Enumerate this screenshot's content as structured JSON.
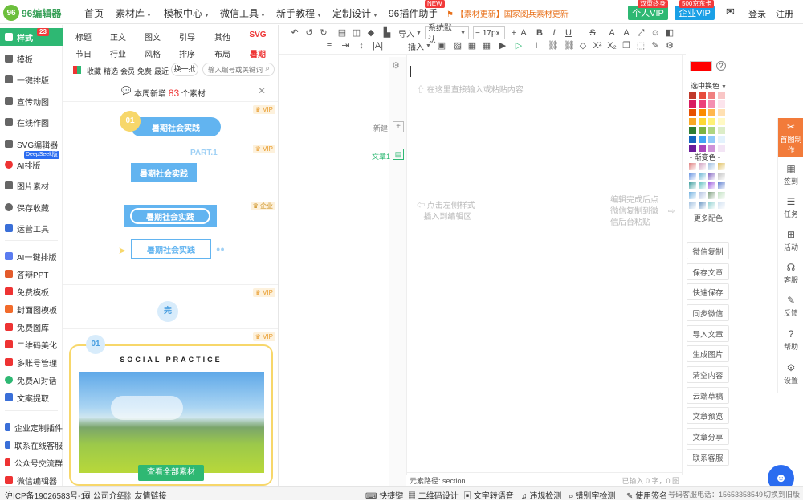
{
  "brand": {
    "name": "96编辑器",
    "accent": "#2eb873"
  },
  "topnav": {
    "items": [
      "首页",
      "素材库",
      "模板中心",
      "微信工具",
      "新手教程",
      "定制设计",
      "96插件助手"
    ],
    "new_badge": "NEW",
    "news": "【素材更新】国家阅兵素材更新",
    "vip_personal": "个人VIP",
    "vip_personal_badge": "双重终身",
    "vip_enterprise": "企业VIP",
    "vip_enterprise_badge": "500京东卡",
    "login": "登录",
    "register": "注册"
  },
  "sidebar": {
    "items": [
      {
        "label": "样式",
        "badge": "23"
      },
      {
        "label": "模板"
      },
      {
        "label": "一键排版"
      },
      {
        "label": "宣传动图"
      },
      {
        "label": "在线作图"
      },
      {
        "label": "SVG编辑器"
      },
      {
        "label": "AI排版",
        "badge": "DeepSeek版"
      },
      {
        "label": "图片素材"
      },
      {
        "label": "保存收藏"
      },
      {
        "label": "运营工具"
      }
    ],
    "tools": [
      "AI一键排版",
      "答辩PPT",
      "免费模板",
      "封面图模板",
      "免费图库",
      "二维码美化",
      "多账号管理",
      "免费AI对话",
      "文案提取"
    ],
    "extras": [
      "企业定制插件",
      "联系在线客服",
      "公众号交流群",
      "微信编辑器"
    ]
  },
  "panel": {
    "cats_row1": [
      "标题",
      "正文",
      "图文",
      "引导",
      "其他",
      "SVG"
    ],
    "cats_row2": [
      "节日",
      "行业",
      "风格",
      "排序",
      "布局",
      "暑期"
    ],
    "filters": [
      "收藏",
      "精选",
      "会员",
      "免费",
      "最近"
    ],
    "swap": "换一批",
    "search_placeholder": "输入编号或关键词",
    "weekly_prefix": "本周新增",
    "weekly_count": "83",
    "weekly_suffix": "个素材",
    "cards": [
      {
        "badge": "VIP",
        "text": "暑期社会实践",
        "num": "01"
      },
      {
        "badge": "VIP",
        "text": "暑期社会实践",
        "deco": "PART.1"
      },
      {
        "badge": "企业",
        "text": "暑期社会实践"
      },
      {
        "badge": "",
        "text": "暑期社会实践"
      },
      {
        "badge": "VIP",
        "text": "完"
      },
      {
        "badge": "VIP",
        "num": "01",
        "title": "SOCIAL PRACTICE",
        "button": "查看全部素材"
      }
    ]
  },
  "toolbar": {
    "import": "导入",
    "font": "系统默认",
    "size": "17px",
    "insert": "插入"
  },
  "editor": {
    "placeholder": "在这里直接输入或粘贴内容",
    "new_label": "新建",
    "article_label": "文章1",
    "hint_left_line1": "点击左侧样式",
    "hint_left_line2": "插入到编辑区",
    "hint_right_line1": "编辑完成后点",
    "hint_right_line2": "微信复制到微",
    "hint_right_line3": "信后台粘贴",
    "path": "元素路径: section",
    "count": "已输入 0 字，0 图"
  },
  "colors": {
    "selected_label": "选中换色",
    "gradient_label": "渐变色",
    "more_label": "更多配色",
    "current": "#ff0000"
  },
  "actions": [
    "微信复制",
    "保存文章",
    "快速保存",
    "同步微信",
    "导入文章",
    "生成图片",
    "清空内容",
    "云端草稿",
    "文章预览",
    "文章分享",
    "联系客服"
  ],
  "rail": [
    {
      "label": "首图制作",
      "icon": "scissors-icon"
    },
    {
      "label": "签到",
      "icon": "calendar-icon"
    },
    {
      "label": "任务",
      "icon": "task-icon"
    },
    {
      "label": "活动",
      "icon": "gift-icon"
    },
    {
      "label": "客服",
      "icon": "headset-icon"
    },
    {
      "label": "反馈",
      "icon": "edit-icon"
    },
    {
      "label": "帮助",
      "icon": "help-icon"
    },
    {
      "label": "设置",
      "icon": "gear-icon"
    }
  ],
  "footer": {
    "icp": "沪ICP备19026583号-16",
    "company": "公司介绍",
    "links": "友情链接",
    "shortcuts": "快捷键",
    "qr": "二维码设计",
    "tts": "文字转语音",
    "check": "违规检测",
    "typo": "错别字检测",
    "sign": "使用签名",
    "phone": "号码客服电话：15653358549",
    "old": "切换到旧版"
  }
}
